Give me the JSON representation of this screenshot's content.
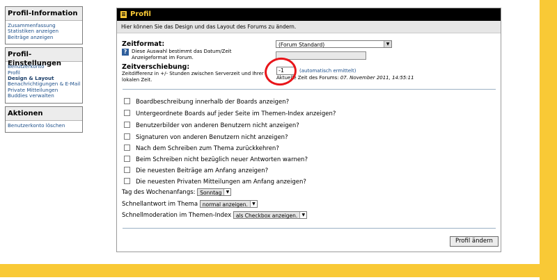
{
  "sidebar": {
    "profile_info": {
      "title": "Profil-Information",
      "links": [
        "Zusammenfassung",
        "Statistiken anzeigen",
        "Beiträge anzeigen"
      ]
    },
    "profile_settings": {
      "title": "Profil-Einstellungen",
      "links": [
        "Benutzerkonto",
        "Profil",
        "Design & Layout",
        "Benachrichtigungen & E-Mail",
        "Private Mitteilungen",
        "Buddies verwalten"
      ]
    },
    "actions": {
      "title": "Aktionen",
      "links": [
        "Benutzerkonto löschen"
      ]
    }
  },
  "panel": {
    "title": "Profil",
    "description": "Hier können Sie das Design und das Layout des Forums zu ändern.",
    "time_format": {
      "label": "Zeitformat:",
      "help": "Diese Auswahl bestimmt das Datum/Zeit Anzeigeformat im Forum.",
      "selected": "(Forum Standard)"
    },
    "time_offset": {
      "label": "Zeitverschiebung:",
      "help": "Zeitdifferenz in +/- Stunden zwischen Serverzeit und Ihrer lokalen Zeit.",
      "value": "-1",
      "auto_link": "(automatisch ermittelt)",
      "current_time_label": "Aktuelle Zeit des Forums:",
      "current_time_value": "07. November 2011, 14:55:11"
    },
    "checkboxes": [
      "Boardbeschreibung innerhalb der Boards anzeigen?",
      "Untergeordnete Boards auf jeder Seite im Themen-Index anzeigen?",
      "Benutzerbilder von anderen Benutzern nicht anzeigen?",
      "Signaturen von anderen Benutzern nicht anzeigen?",
      "Nach dem Schreiben zum Thema zurückkehren?",
      "Beim Schreiben nicht bezüglich neuer Antworten warnen?",
      "Die neuesten Beiträge am Anfang anzeigen?",
      "Die neuesten Privaten Mitteilungen am Anfang anzeigen?"
    ],
    "options": {
      "week_start_label": "Tag des Wochenanfangs:",
      "week_start_value": "Sonntag",
      "quick_reply_label": "Schnellantwort im Thema",
      "quick_reply_value": "normal anzeigen.",
      "quick_mod_label": "Schnellmoderation im Themen-Index",
      "quick_mod_value": "als Checkbox anzeigen."
    },
    "submit_label": "Profil ändern"
  },
  "icons": {
    "title": "document-icon",
    "help": "help-icon",
    "dropdown": "chevron-down-icon"
  },
  "colors": {
    "accent_yellow": "#f9c936",
    "titlebar": "#000000",
    "link": "#1c4f8a",
    "annotation_red": "#e8151a"
  }
}
